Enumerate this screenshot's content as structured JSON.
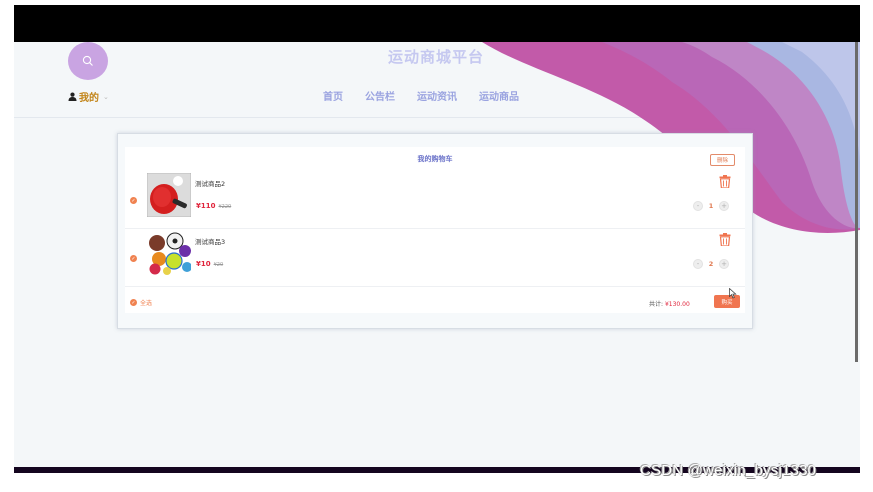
{
  "header": {
    "site_title": "运动商城平台",
    "user_label": "我的",
    "user_caret": "⌄",
    "nav": [
      "首页",
      "公告栏",
      "运动资讯",
      "运动商品"
    ]
  },
  "cart": {
    "title": "我的购物车",
    "delete_label": "删除",
    "items": [
      {
        "name": "测试商品2",
        "price": "¥110",
        "old_price": "¥220",
        "qty": "1"
      },
      {
        "name": "测试商品3",
        "price": "¥10",
        "old_price": "¥20",
        "qty": "2"
      }
    ],
    "select_all_label": "全选",
    "total_label": "共计:",
    "total_value": "¥130.00",
    "buy_label": "购买"
  },
  "icons": {
    "search": "search-icon",
    "user": "user-icon",
    "trash": "trash-icon",
    "check": "check-circle-icon"
  },
  "colors": {
    "accent": "#f07550",
    "price": "#e0243b",
    "title": "#6b73c9",
    "wave_pink": "#c05aa8",
    "wave_blue": "#a8b4e0"
  },
  "watermark": "CSDN @weixin_bysj1330"
}
